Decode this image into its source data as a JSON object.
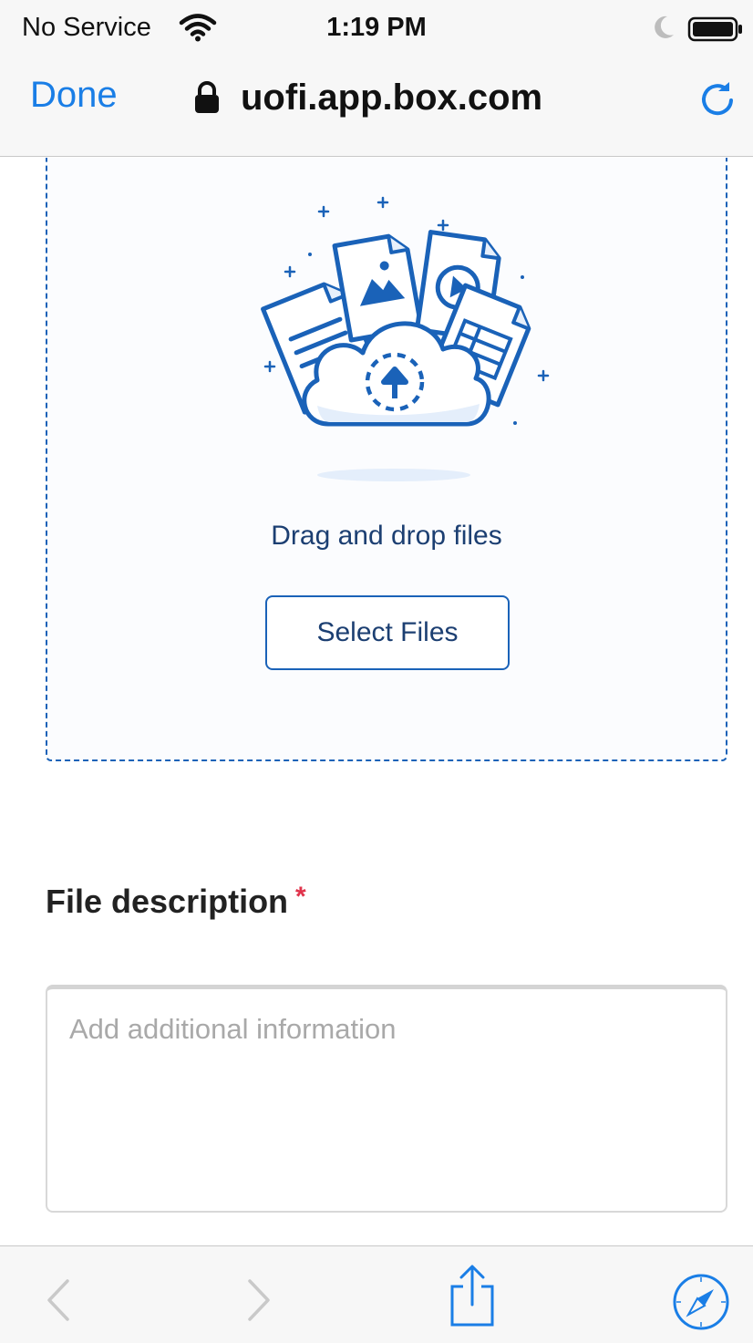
{
  "status_bar": {
    "carrier": "No Service",
    "time": "1:19 PM",
    "icons": [
      "wifi-icon",
      "moon-icon",
      "battery-icon"
    ]
  },
  "browser": {
    "done_label": "Done",
    "url": "uofi.app.box.com",
    "icons": [
      "lock-icon",
      "reload-icon"
    ]
  },
  "upload": {
    "drag_text": "Drag and drop files",
    "select_button": "Select Files"
  },
  "form": {
    "description_label": "File description",
    "required_marker": "*",
    "description_placeholder": "Add additional information",
    "description_value": ""
  },
  "toolbar": {
    "icons": [
      "back-icon",
      "forward-icon",
      "share-icon",
      "compass-icon"
    ]
  },
  "colors": {
    "ios_blue": "#1a7ee6",
    "box_blue": "#1a62b8",
    "text_navy": "#1c3f72",
    "required_red": "#e0334b"
  }
}
